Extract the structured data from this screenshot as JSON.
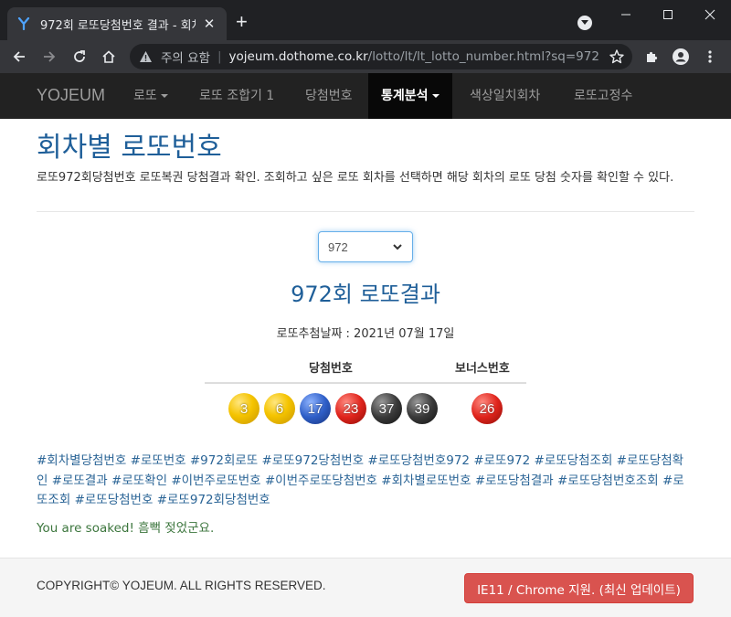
{
  "browser": {
    "tab_title": "972회 로또당첨번호 결과 - 회차",
    "new_tab": "+",
    "tab_close": "✕",
    "security_label": "주의 요함",
    "url_host": "yojeum.dothome.co.kr",
    "url_path": "/lotto/lt/lt_lotto_number.html?sq=972"
  },
  "nav": {
    "brand": "YOJEUM",
    "items": [
      {
        "label": "로또",
        "dropdown": true
      },
      {
        "label": "로또 조합기 1",
        "dropdown": false
      },
      {
        "label": "당첨번호",
        "dropdown": false
      },
      {
        "label": "통계분석",
        "dropdown": true,
        "active": true
      },
      {
        "label": "색상일치회차",
        "dropdown": false
      },
      {
        "label": "로또고정수",
        "dropdown": false
      }
    ]
  },
  "main": {
    "title": "회차별 로또번호",
    "description": "로또972회당첨번호 로또복권 당첨결과 확인. 조회하고 싶은 로또 회차를 선택하면 해당 회차의 로또 당첨 숫자를 확인할 수 있다.",
    "round_select": {
      "value": "972"
    },
    "result_title": "972회 로또결과",
    "draw_date": "로또추첨날짜 : 2021년 07월 17일",
    "winning_header": "당첨번호",
    "bonus_header": "보너스번호",
    "balls": [
      {
        "number": "3",
        "color": "#f5c400"
      },
      {
        "number": "6",
        "color": "#f5c400"
      },
      {
        "number": "17",
        "color": "#2f5fc8"
      },
      {
        "number": "23",
        "color": "#e0241c"
      },
      {
        "number": "37",
        "color": "#3a3a3a"
      },
      {
        "number": "39",
        "color": "#3a3a3a"
      }
    ],
    "bonus_ball": {
      "number": "26",
      "color": "#e0241c"
    },
    "tags": [
      "#회차별당첨번호",
      "#로또번호",
      "#972회로또",
      "#로또972당첨번호",
      "#로또당첨번호972",
      "#로또972",
      "#로또당첨조회",
      "#로또당첨확인",
      "#로또결과",
      "#로또확인",
      "#이번주로또번호",
      "#이번주로또당첨번호",
      "#회차별로또번호",
      "#로또당첨결과",
      "#로또당첨번호조회",
      "#로또조회",
      "#로또당첨번호",
      "#로또972회당첨번호"
    ],
    "soaked_text": "You are soaked! 흠뻑 젖었군요."
  },
  "footer": {
    "copyright": "COPYRIGHT© YOJEUM. ALL RIGHTS RESERVED.",
    "support_button": "IE11 / Chrome 지원. (최신 업데이트)"
  },
  "colors": {
    "nav_bg": "#222222",
    "title_blue": "#1f5f99",
    "tag_blue": "#2a6496",
    "danger": "#d9534f"
  }
}
